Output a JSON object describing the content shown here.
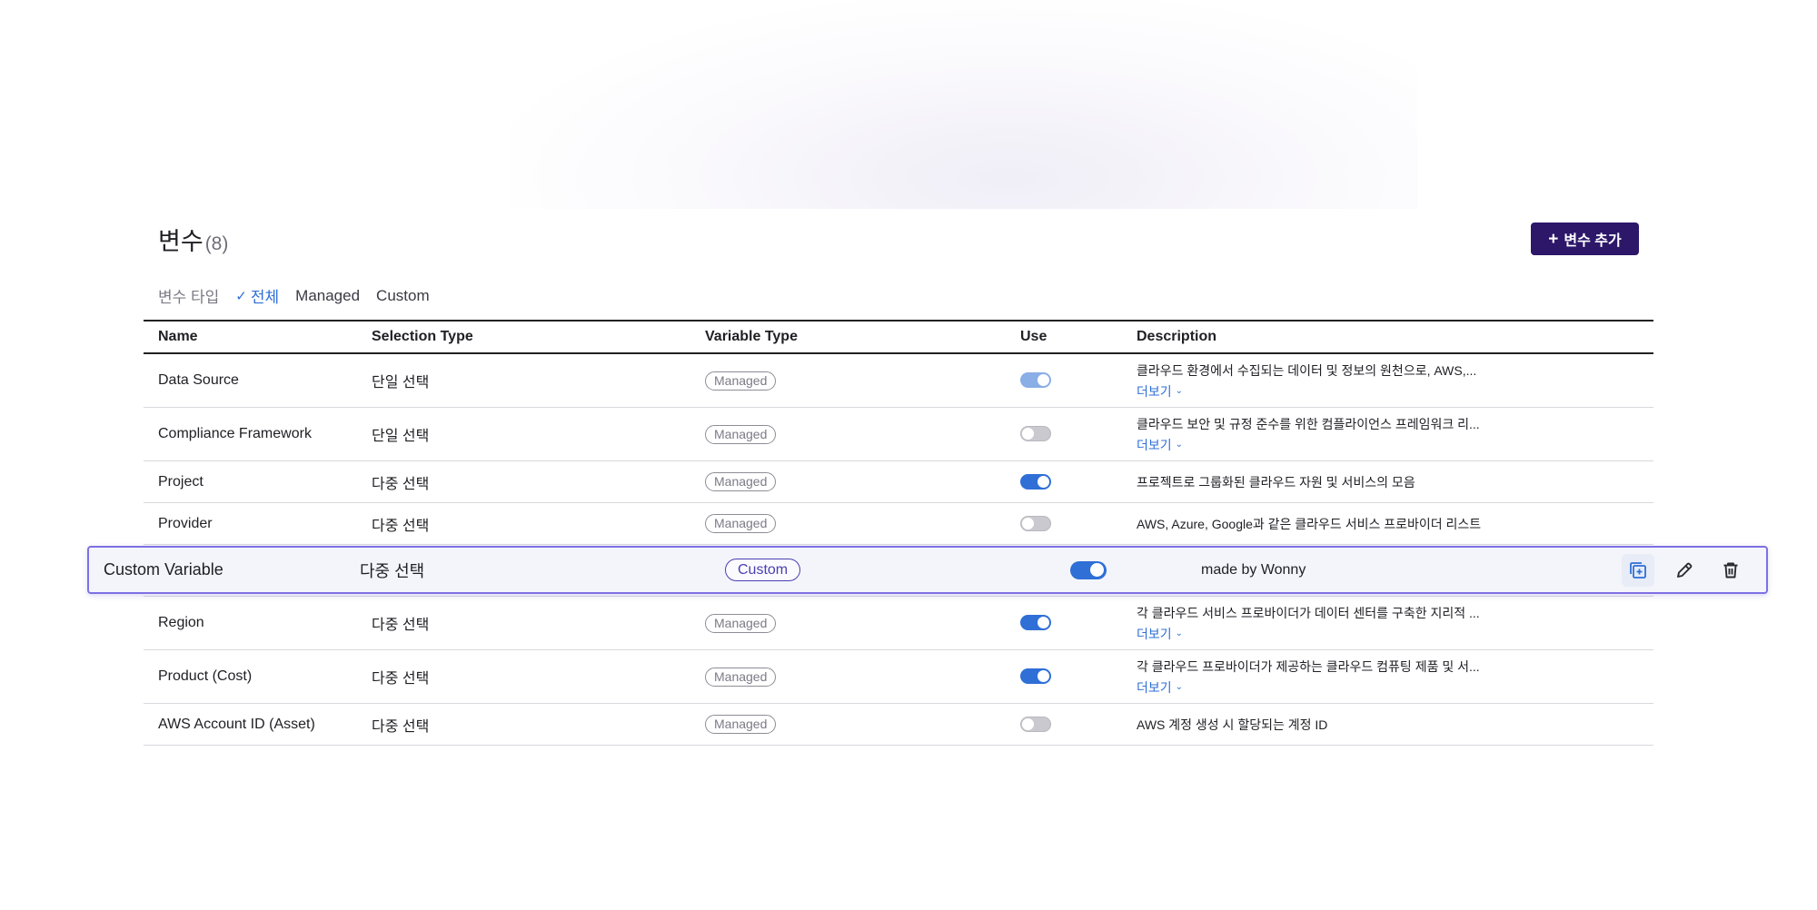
{
  "header": {
    "title": "변수",
    "count": "(8)",
    "add_button_label": "변수 추가",
    "add_button_plus": "+"
  },
  "filter": {
    "label": "변수 타입",
    "options": [
      "전체",
      "Managed",
      "Custom"
    ],
    "selected": "전체",
    "check_glyph": "✓"
  },
  "table": {
    "columns": [
      "Name",
      "Selection Type",
      "Variable Type",
      "Use",
      "Description"
    ],
    "more_label": "더보기",
    "more_chev": "⌄",
    "rows": [
      {
        "name": "Data Source",
        "selection": "단일 선택",
        "type": "Managed",
        "use": "on-light",
        "description": "클라우드 환경에서 수집되는 데이터 및 정보의 원천으로, AWS,...",
        "has_more": true
      },
      {
        "name": "Compliance Framework",
        "selection": "단일 선택",
        "type": "Managed",
        "use": "off",
        "description": "클라우드 보안 및 규정 준수를 위한 컴플라이언스 프레임워크 리...",
        "has_more": true
      },
      {
        "name": "Project",
        "selection": "다중 선택",
        "type": "Managed",
        "use": "on",
        "description": "프로젝트로 그룹화된 클라우드 자원 및 서비스의 모음",
        "has_more": false
      },
      {
        "name": "Provider",
        "selection": "다중 선택",
        "type": "Managed",
        "use": "off",
        "description": "AWS, Azure, Google과 같은 클라우드 서비스 프로바이더 리스트",
        "has_more": false
      },
      {
        "name": "Region",
        "selection": "다중 선택",
        "type": "Managed",
        "use": "on",
        "description": "각 클라우드 서비스 프로바이더가 데이터 센터를 구축한 지리적 ...",
        "has_more": true
      },
      {
        "name": "Product (Cost)",
        "selection": "다중 선택",
        "type": "Managed",
        "use": "on",
        "description": "각 클라우드 프로바이더가 제공하는 클라우드 컴퓨팅 제품 및 서...",
        "has_more": true
      },
      {
        "name": "AWS Account ID (Asset)",
        "selection": "다중 선택",
        "type": "Managed",
        "use": "off",
        "description": "AWS 계정 생성 시 할당되는 계정 ID",
        "has_more": false
      }
    ]
  },
  "highlighted_row": {
    "name": "Custom Variable",
    "selection": "다중 선택",
    "type": "Custom",
    "use": "on",
    "description": "made by Wonny",
    "actions": [
      "copy-icon",
      "edit-icon",
      "delete-icon"
    ]
  },
  "colors": {
    "accent": "#2f6fd6",
    "primary_button": "#2c1769",
    "highlight_border": "#7d70e3",
    "custom_badge": "#4a3fb0"
  }
}
